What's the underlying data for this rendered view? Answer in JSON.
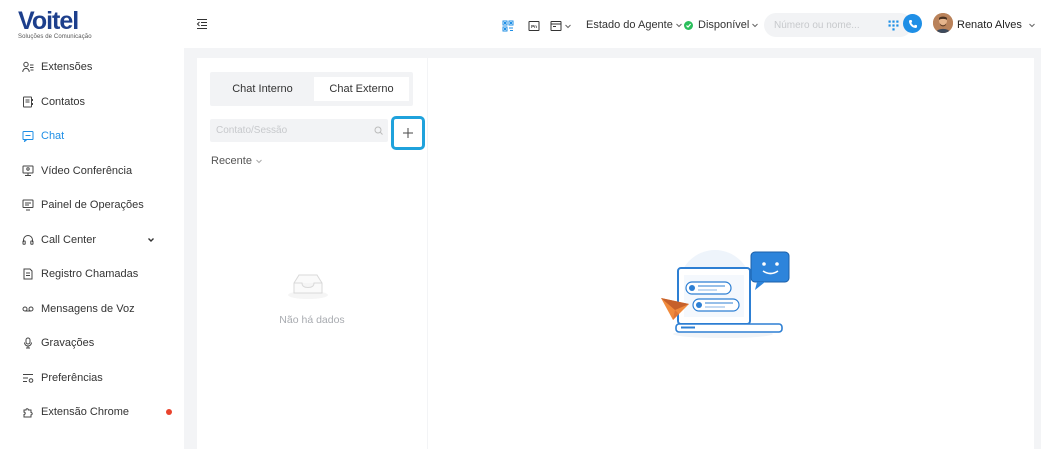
{
  "brand": {
    "name": "Voitel",
    "tagline": "Soluções de Comunicação",
    "color": "#1d3f8c"
  },
  "accent_color": "#1f8fe6",
  "sidebar": {
    "items": [
      {
        "label": "Extensões",
        "icon": "users-icon",
        "active": false
      },
      {
        "label": "Contatos",
        "icon": "contacts-icon",
        "active": false
      },
      {
        "label": "Chat",
        "icon": "chat-icon",
        "active": true
      },
      {
        "label": "Vídeo Conferência",
        "icon": "video-conference-icon",
        "active": false
      },
      {
        "label": "Painel de Operações",
        "icon": "operations-panel-icon",
        "active": false
      },
      {
        "label": "Call Center",
        "icon": "headset-icon",
        "active": false,
        "expandable": true
      },
      {
        "label": "Registro Chamadas",
        "icon": "call-log-icon",
        "active": false
      },
      {
        "label": "Mensagens de Voz",
        "icon": "voicemail-icon",
        "active": false
      },
      {
        "label": "Gravações",
        "icon": "microphone-icon",
        "active": false
      },
      {
        "label": "Preferências",
        "icon": "preferences-icon",
        "active": false
      },
      {
        "label": "Extensão Chrome",
        "icon": "chrome-extension-icon",
        "active": false,
        "badge_dot": true
      }
    ]
  },
  "header": {
    "agent_state_label": "Estado do Agente",
    "status_label": "Disponível",
    "status_color": "#2bbf5c",
    "dial_placeholder": "Número ou nome...",
    "user_name": "Renato Alves"
  },
  "chat": {
    "tabs": [
      {
        "label": "Chat Interno",
        "selected": false
      },
      {
        "label": "Chat Externo",
        "selected": true
      }
    ],
    "search_placeholder": "Contato/Sessão",
    "add_label": "+",
    "filter_label": "Recente",
    "empty_text": "Não há dados"
  }
}
